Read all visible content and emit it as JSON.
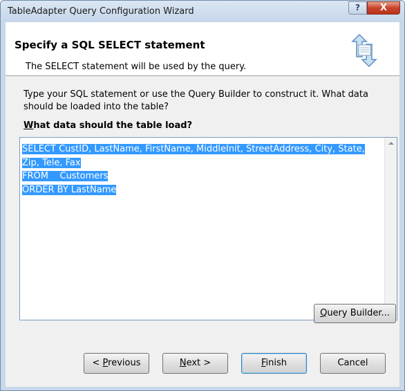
{
  "window": {
    "title": "TableAdapter Query Configuration Wizard",
    "help_glyph": "?",
    "close_glyph": "X"
  },
  "header": {
    "title": "Specify a SQL SELECT statement",
    "subtitle": "The SELECT statement will be used by the query.",
    "icon": "wizard-arrows-icon"
  },
  "instruction": "Type your SQL statement or use the Query Builder to construct it. What data should be loaded into the table?",
  "prompt": {
    "accel": "W",
    "rest": "hat data should the table load?"
  },
  "sql": {
    "lines": [
      "SELECT CustID, LastName, FirstName, MiddleInit, StreetAddress, City, State,",
      "Zip, Tele, Fax",
      "FROM    Customers",
      "ORDER BY LastName"
    ],
    "selected": true
  },
  "buttons": {
    "query_builder": {
      "accel": "Q",
      "rest": "uery Builder..."
    },
    "previous": {
      "pre": "< ",
      "accel": "P",
      "rest": "revious"
    },
    "next": {
      "accel": "N",
      "rest": "ext >"
    },
    "finish": {
      "accel": "F",
      "rest": "inish"
    },
    "cancel": {
      "label": "Cancel"
    }
  },
  "colors": {
    "selection": "#3399ff",
    "frame": "#c8d8ea",
    "close": "#c9432a"
  }
}
